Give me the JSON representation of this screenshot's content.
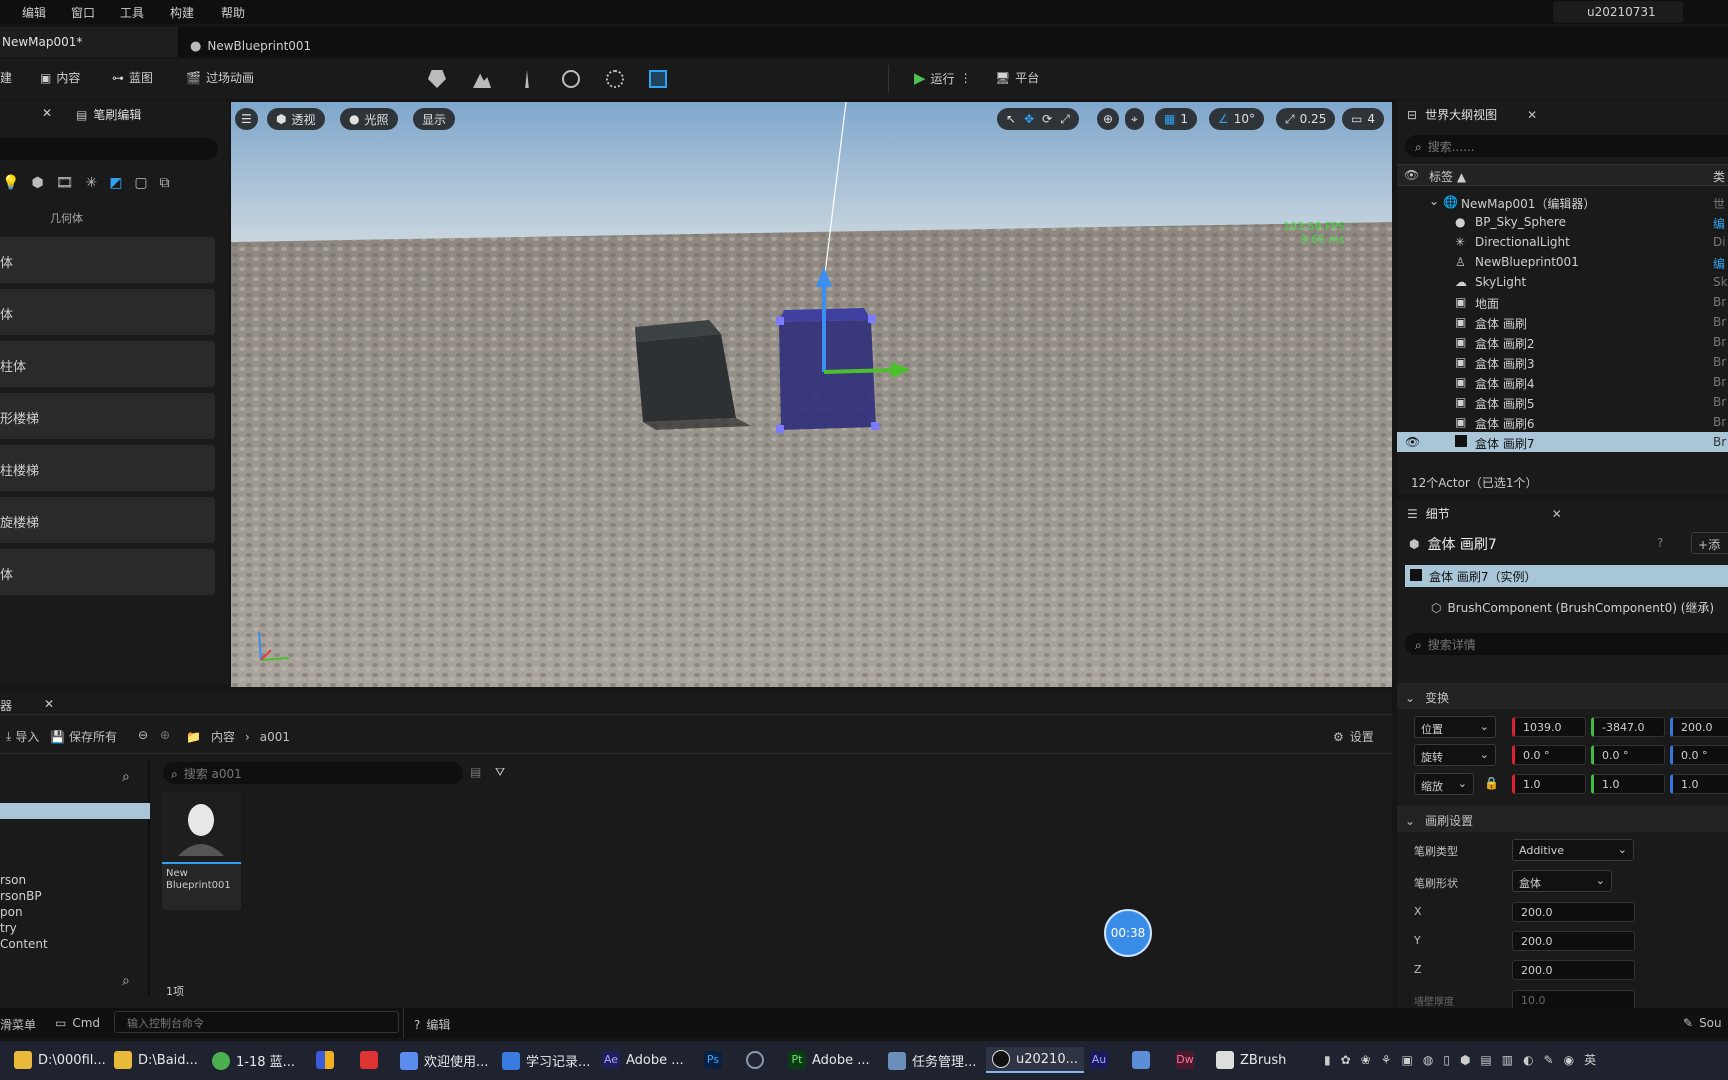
{
  "menu": [
    "编辑",
    "窗口",
    "工具",
    "构建",
    "帮助"
  ],
  "user": "u20210731",
  "tabs": {
    "map": "NewMap001*",
    "blueprint": "NewBlueprint001"
  },
  "toolbar": {
    "create": "创建",
    "content": "内容",
    "blueprint": "蓝图",
    "cinematics": "过场动画",
    "play": "运行",
    "platform": "平台"
  },
  "left_panel": {
    "tab_title": "笔刷编辑",
    "category": "几何体",
    "items": [
      "体",
      "体",
      "柱体",
      "形楼梯",
      "柱楼梯",
      "旋楼梯",
      "体"
    ]
  },
  "viewport": {
    "perspective": "透视",
    "lit": "光照",
    "show": "显示",
    "grid": "1",
    "angle": "10°",
    "scale": "0.25",
    "camera": "4",
    "fps": "103.59 FPS",
    "ms": "9.65 ms"
  },
  "outliner": {
    "title": "世界大纲视图",
    "search_placeholder": "搜索......",
    "col_label": "标签 ▲",
    "col_type": "类",
    "rows": [
      {
        "name": "NewMap001（编辑器）",
        "type": "世"
      },
      {
        "name": "BP_Sky_Sphere",
        "type": "编"
      },
      {
        "name": "DirectionalLight",
        "type": "Di"
      },
      {
        "name": "NewBlueprint001",
        "type": "编"
      },
      {
        "name": "SkyLight",
        "type": "Sk"
      },
      {
        "name": "地面",
        "type": "Br"
      },
      {
        "name": "盒体 画刷",
        "type": "Br"
      },
      {
        "name": "盒体 画刷2",
        "type": "Br"
      },
      {
        "name": "盒体 画刷3",
        "type": "Br"
      },
      {
        "name": "盒体 画刷4",
        "type": "Br"
      },
      {
        "name": "盒体 画刷5",
        "type": "Br"
      },
      {
        "name": "盒体 画刷6",
        "type": "Br"
      },
      {
        "name": "盒体 画刷7",
        "type": "Br"
      }
    ],
    "count": "12个Actor（已选1个）"
  },
  "details": {
    "title": "细节",
    "actor_name": "盒体 画刷7",
    "add_label": "添",
    "instance": "盒体 画刷7（实例）",
    "component": "BrushComponent (BrushComponent0) (继承)",
    "search_placeholder": "搜索详情",
    "transform_section": "变换",
    "location_label": "位置",
    "rotation_label": "旋转",
    "scale_label": "缩放",
    "location": [
      "1039.0",
      "-3847.0",
      "200.0"
    ],
    "rotation": [
      "0.0 °",
      "0.0 °",
      "0.0 °"
    ],
    "scale": [
      "1.0",
      "1.0",
      "1.0"
    ],
    "brush_section": "画刷设置",
    "brush_type_label": "笔刷类型",
    "brush_type": "Additive",
    "brush_shape_label": "笔刷形状",
    "brush_shape": "盒体",
    "x_label": "X",
    "x": "200.0",
    "y_label": "Y",
    "y": "200.0",
    "z_label": "Z",
    "z": "200.0",
    "wall_label": "墙壁厚度",
    "wall": "10.0"
  },
  "content": {
    "import": "导入",
    "save_all": "保存所有",
    "path_root": "内容",
    "path_leaf": "a001",
    "settings": "设置",
    "search_placeholder": "搜索 a001",
    "tree": [
      "rson",
      "rsonBP",
      "pon",
      "try",
      "Content"
    ],
    "asset_name": "New Blueprint001",
    "item_count": "1项",
    "timer": "00:38"
  },
  "bottom": {
    "drawer": "内容侧滑菜单",
    "cmd": "Cmd",
    "console_placeholder": "输入控制台命令",
    "edit": "编辑",
    "source": "Sou"
  },
  "taskbar": [
    {
      "label": "D:\\000fil...",
      "color": "#e8b93a"
    },
    {
      "label": "D:\\Baid...",
      "color": "#e8b93a"
    },
    {
      "label": "1-18 蓝...",
      "color": "#4caf50"
    },
    {
      "label": "欢迎使用...",
      "color": "#5b8def"
    },
    {
      "label": "学习记录...",
      "color": "#3b7be0"
    },
    {
      "label": "Adobe ...",
      "color": "#1f1f5a"
    },
    {
      "label": "Adobe ...",
      "color": "#0c3b12"
    },
    {
      "label": "任务管理...",
      "color": "#6a8fb8"
    },
    {
      "label": "u20210...",
      "color": "#333333"
    },
    {
      "label": "ZBrush",
      "color": "#333333"
    }
  ],
  "tray_lang": "英"
}
